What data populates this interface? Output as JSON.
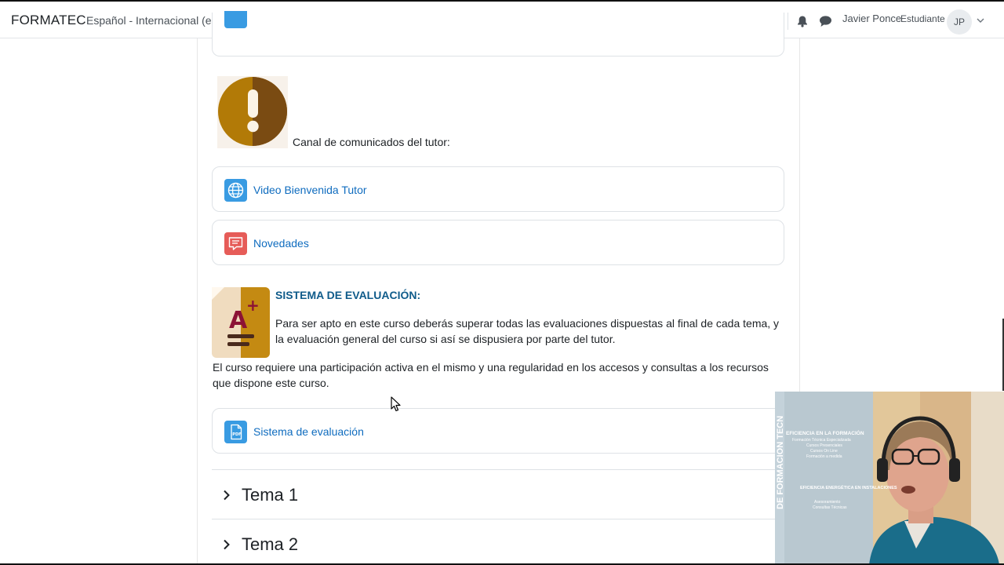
{
  "navbar": {
    "brand": "FORMATEC",
    "language": "Español - Internacional (es)",
    "user_name": "Javier Ponce",
    "user_role": "Estudiante",
    "user_initials": "JP"
  },
  "content": {
    "announcement_label": "Canal de comunicados del tutor:",
    "activities": [
      {
        "label": "Video Bienvenida Tutor",
        "icon": "globe-icon"
      },
      {
        "label": "Novedades",
        "icon": "forum-icon"
      }
    ],
    "evaluation": {
      "title": "SISTEMA DE EVALUACIÓN:",
      "paragraph1": "Para ser apto en este curso deberás superar todas las evaluaciones dispuestas al final de cada tema, y la evaluación general del curso si así se dispusiera por parte del tutor.",
      "paragraph2": "El curso requiere una participación activa en el mismo y una regularidad en los accesos y consultas a los recursos que dispone este curso.",
      "resource_label": "Sistema de evaluación",
      "resource_icon": "pdf-icon"
    },
    "sections": [
      {
        "label": "Tema 1"
      },
      {
        "label": "Tema 2"
      }
    ]
  },
  "webcam": {
    "poster_lines": [
      "EFICIENCIA EN LA FORMACIÓN",
      "Formación Técnica Especializada",
      "Cursos Presenciales",
      "Cursos On Line",
      "Formación a medida",
      "EFICIENCIA ENERGÉTICA EN INSTALACIONES",
      "Asesoramiento",
      "Consultas Técnicas"
    ],
    "vertical_text": "DE FORMACION TECN"
  },
  "colors": {
    "link": "#0f6cbf",
    "globe_icon_bg": "#399be2",
    "forum_icon_bg": "#e65c58",
    "pdf_icon_bg": "#399be2",
    "eval_title": "#0f5b8a"
  }
}
